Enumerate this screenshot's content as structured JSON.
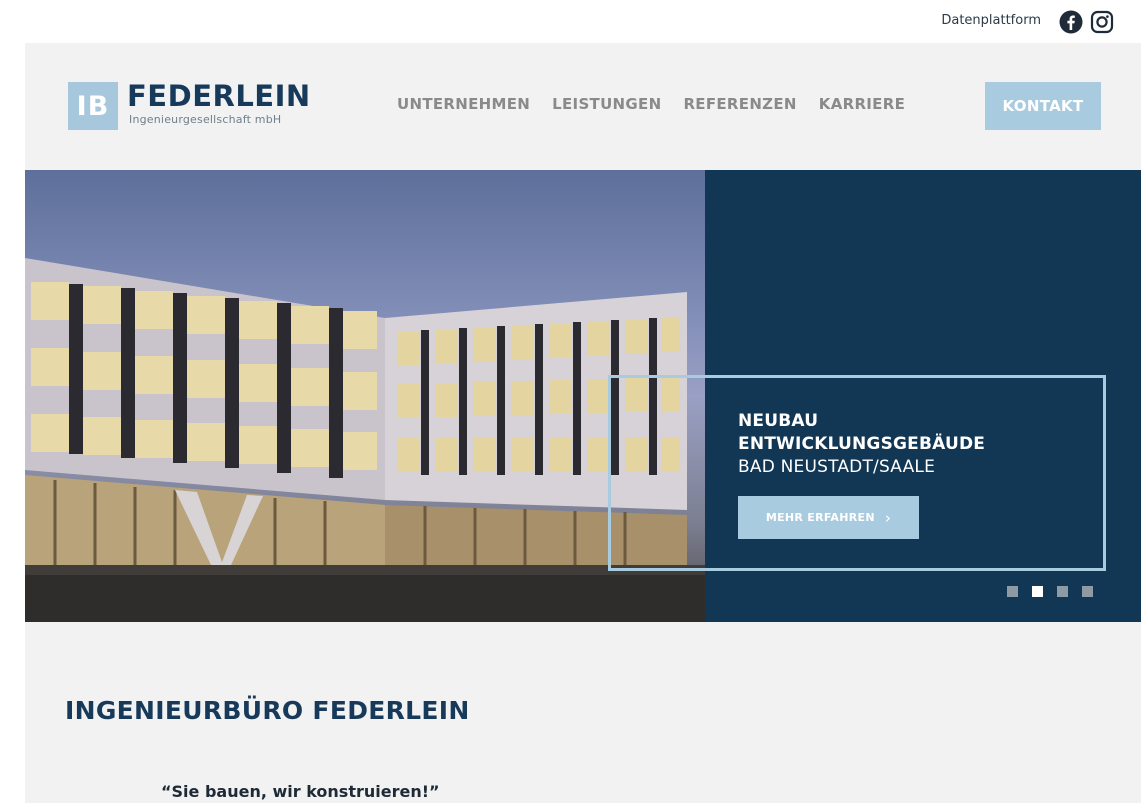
{
  "topbar": {
    "data_platform_label": "Datenplattform",
    "icons": [
      "facebook-icon",
      "instagram-icon"
    ]
  },
  "brand": {
    "logo_initials": "IB",
    "name": "FEDERLEIN",
    "subtitle": "Ingenieurgesellschaft mbH"
  },
  "nav": {
    "items": [
      "UNTERNEHMEN",
      "LEISTUNGEN",
      "REFERENZEN",
      "KARRIERE"
    ],
    "contact_label": "KONTAKT"
  },
  "hero": {
    "title_line1": "NEUBAU",
    "title_line2": "ENTWICKLUNGSGEBÄUDE",
    "subtitle": "BAD NEUSTADT/SAALE",
    "button_label": "MEHR ERFAHREN",
    "slide_count": 4,
    "active_slide": 2
  },
  "intro": {
    "heading": "INGENIEURBÜRO FEDERLEIN",
    "quote": "“Sie bauen, wir konstruieren!”"
  },
  "colors": {
    "brand_dark": "#173a5a",
    "hero_panel": "#123754",
    "accent_light_blue": "#a9cbe0",
    "nav_gray": "#8a8a8a",
    "section_bg": "#f2f2f2"
  }
}
